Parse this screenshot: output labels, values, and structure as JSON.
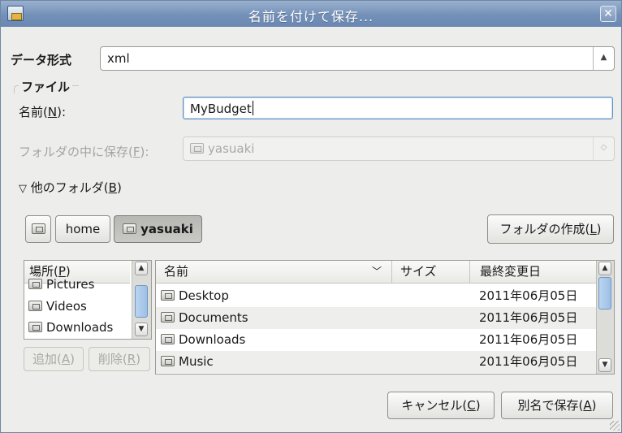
{
  "window": {
    "title": "名前を付けて保存..."
  },
  "format": {
    "label": "データ形式",
    "value": "xml"
  },
  "file_section": {
    "label": "ファイル"
  },
  "name_field": {
    "label_pre": "名前(",
    "label_key": "N",
    "label_post": "):",
    "value": "MyBudget"
  },
  "save_in": {
    "label_pre": "フォルダの中に保存(",
    "label_key": "F",
    "label_post": "):",
    "value": "yasuaki"
  },
  "other_folders": {
    "label_pre": "他のフォルダ(",
    "label_key": "B",
    "label_post": ")"
  },
  "path_bar": {
    "items": [
      "home",
      "yasuaki"
    ]
  },
  "create_folder": {
    "label_pre": "フォルダの作成(",
    "label_key": "L",
    "label_post": ")"
  },
  "places": {
    "header_pre": "場所(",
    "header_key": "P",
    "header_post": ")",
    "items": [
      "Pictures",
      "Videos",
      "Downloads"
    ],
    "add_pre": "追加(",
    "add_key": "A",
    "add_post": ")",
    "remove_pre": "削除(",
    "remove_key": "R",
    "remove_post": ")"
  },
  "file_list": {
    "columns": {
      "name": "名前",
      "size": "サイズ",
      "modified": "最終変更日"
    },
    "rows": [
      {
        "name": "Desktop",
        "size": "",
        "modified": "2011年06月05日"
      },
      {
        "name": "Documents",
        "size": "",
        "modified": "2011年06月05日"
      },
      {
        "name": "Downloads",
        "size": "",
        "modified": "2011年06月05日"
      },
      {
        "name": "Music",
        "size": "",
        "modified": "2011年06月05日"
      }
    ]
  },
  "actions": {
    "cancel_pre": "キャンセル(",
    "cancel_key": "C",
    "cancel_post": ")",
    "save_pre": "別名で保存(",
    "save_key": "A",
    "save_post": ")"
  },
  "icons": {
    "close": "close-icon",
    "chevron": "updown-chevron-icon",
    "expander": "triangle-down-icon",
    "folder": "folder-icon",
    "home": "home-folder-icon"
  }
}
